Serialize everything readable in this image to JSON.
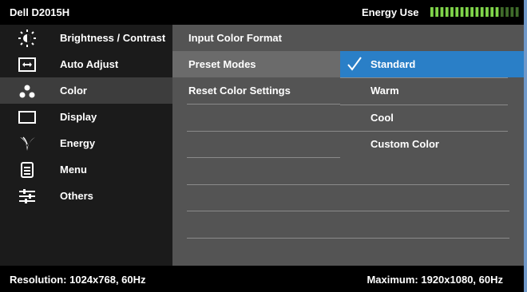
{
  "header": {
    "model": "Dell D2015H",
    "energy_label": "Energy Use",
    "energy_bars_total": 18,
    "energy_bars_active": 14,
    "energy_active_color": "#7fd44a",
    "energy_inactive_color": "#3f6b2a"
  },
  "sidebar": {
    "items": [
      {
        "label": "Brightness / Contrast",
        "icon": "brightness-icon"
      },
      {
        "label": "Auto Adjust",
        "icon": "auto-adjust-icon"
      },
      {
        "label": "Color",
        "icon": "color-icon"
      },
      {
        "label": "Display",
        "icon": "display-icon"
      },
      {
        "label": "Energy",
        "icon": "energy-icon"
      },
      {
        "label": "Menu",
        "icon": "menu-icon"
      },
      {
        "label": "Others",
        "icon": "others-icon"
      }
    ],
    "selected": "Color"
  },
  "color_menu": {
    "items": [
      {
        "label": "Input Color Format"
      },
      {
        "label": "Preset Modes"
      },
      {
        "label": "Reset Color Settings"
      }
    ],
    "selected": "Preset Modes"
  },
  "preset_modes": {
    "options": [
      {
        "label": "Standard"
      },
      {
        "label": "Warm"
      },
      {
        "label": "Cool"
      },
      {
        "label": "Custom Color"
      }
    ],
    "selected": "Standard",
    "selected_color": "#2a7fc7"
  },
  "status": {
    "resolution": "Resolution: 1024x768, 60Hz",
    "maximum": "Maximum: 1920x1080, 60Hz"
  }
}
